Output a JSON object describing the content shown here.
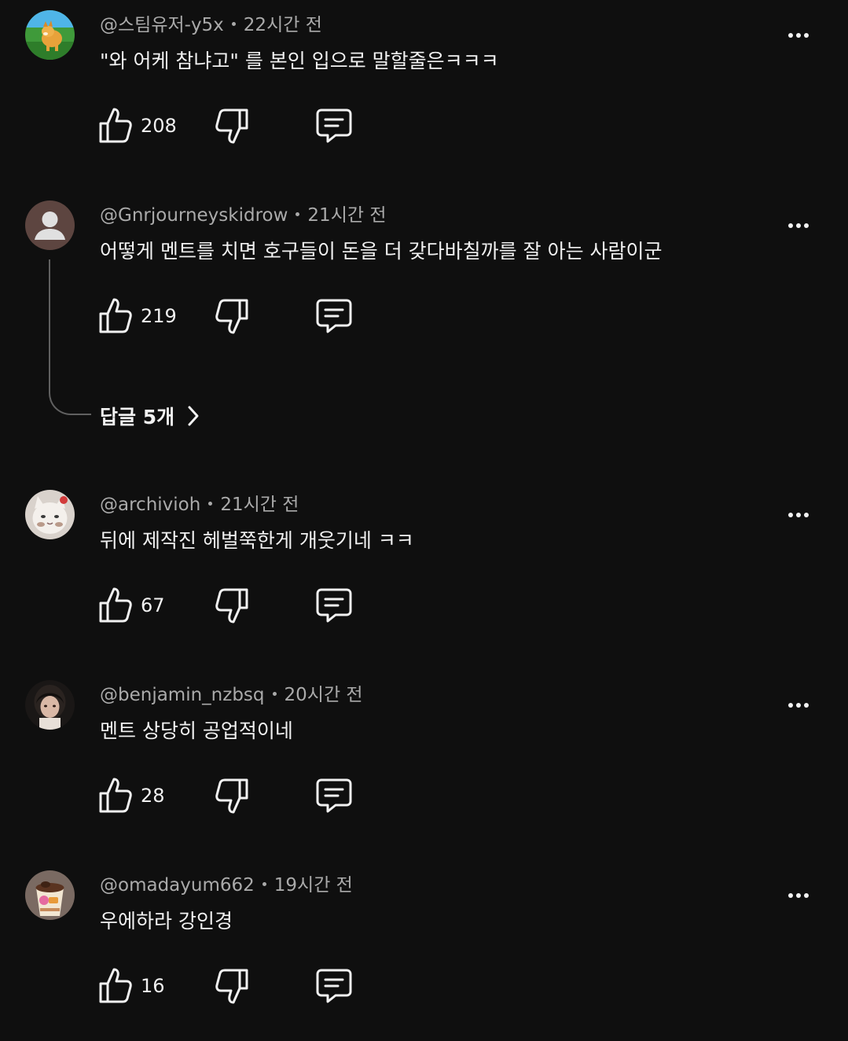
{
  "comments": [
    {
      "author": "@스팀유저-y5x",
      "time": "22시간 전",
      "text": "\"와 어케 참냐고\" 를 본인 입으로 말할줄은ㅋㅋㅋ",
      "likes": "208",
      "avatar_icon": "shiba-dog-avatar"
    },
    {
      "author": "@Gnrjourneyskidrow",
      "time": "21시간 전",
      "text": "어떻게 멘트를 치면 호구들이 돈을 더 갖다바칠까를 잘 아는 사람이군",
      "likes": "219",
      "avatar_icon": "default-user-avatar",
      "replies_label": "답글 5개"
    },
    {
      "author": "@archivioh",
      "time": "21시간 전",
      "text": "뒤에 제작진 헤벌쭉한게 개웃기네 ㅋㅋ",
      "likes": "67",
      "avatar_icon": "white-cat-avatar"
    },
    {
      "author": "@benjamin_nzbsq",
      "time": "20시간 전",
      "text": "멘트 상당히 공업적이네",
      "likes": "28",
      "avatar_icon": "person-photo-avatar"
    },
    {
      "author": "@omadayum662",
      "time": "19시간 전",
      "text": "우에하라 강인경",
      "likes": "16",
      "avatar_icon": "ice-cream-cup-avatar"
    }
  ],
  "colors": {
    "background": "#0f0f0f",
    "primary_text": "#f1f1f1",
    "secondary_text": "#aaaaaa",
    "thread_line": "#606060"
  }
}
